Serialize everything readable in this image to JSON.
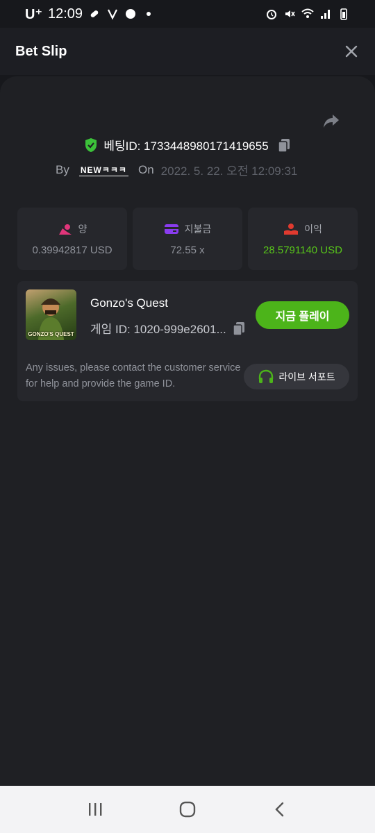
{
  "status_bar": {
    "carrier": "U⁺",
    "time": "12:09"
  },
  "header": {
    "title": "Bet Slip"
  },
  "bet": {
    "id_text": "베팅ID: 1733448980171419655",
    "by_label": "By",
    "user_name": "NEWㅋㅋㅋ",
    "on_label": "On",
    "date": "2022. 5. 22. 오전 12:09:31"
  },
  "stats": [
    {
      "label": "양",
      "value": "0.39942817 USD",
      "icon": "bet-amount-icon",
      "color": "#e0357a"
    },
    {
      "label": "지불금",
      "value": "72.55 x",
      "icon": "card-icon",
      "color": "#8a3cf0"
    },
    {
      "label": "이익",
      "value": "28.5791140 USD",
      "icon": "profit-icon",
      "color": "#e03a2f"
    }
  ],
  "game": {
    "thumb_label": "GONZO'S QUEST",
    "title": "Gonzo's Quest",
    "id_text": "게임 ID: 1020-999e2601...",
    "play_label": "지금 플레이",
    "support_text": "Any issues, please contact the customer service for help and provide the game ID.",
    "support_label": "라이브 서포트"
  },
  "colors": {
    "accent_green": "#4cb41a",
    "profit_green": "#57c41a",
    "shield_green": "#3cc23a"
  }
}
